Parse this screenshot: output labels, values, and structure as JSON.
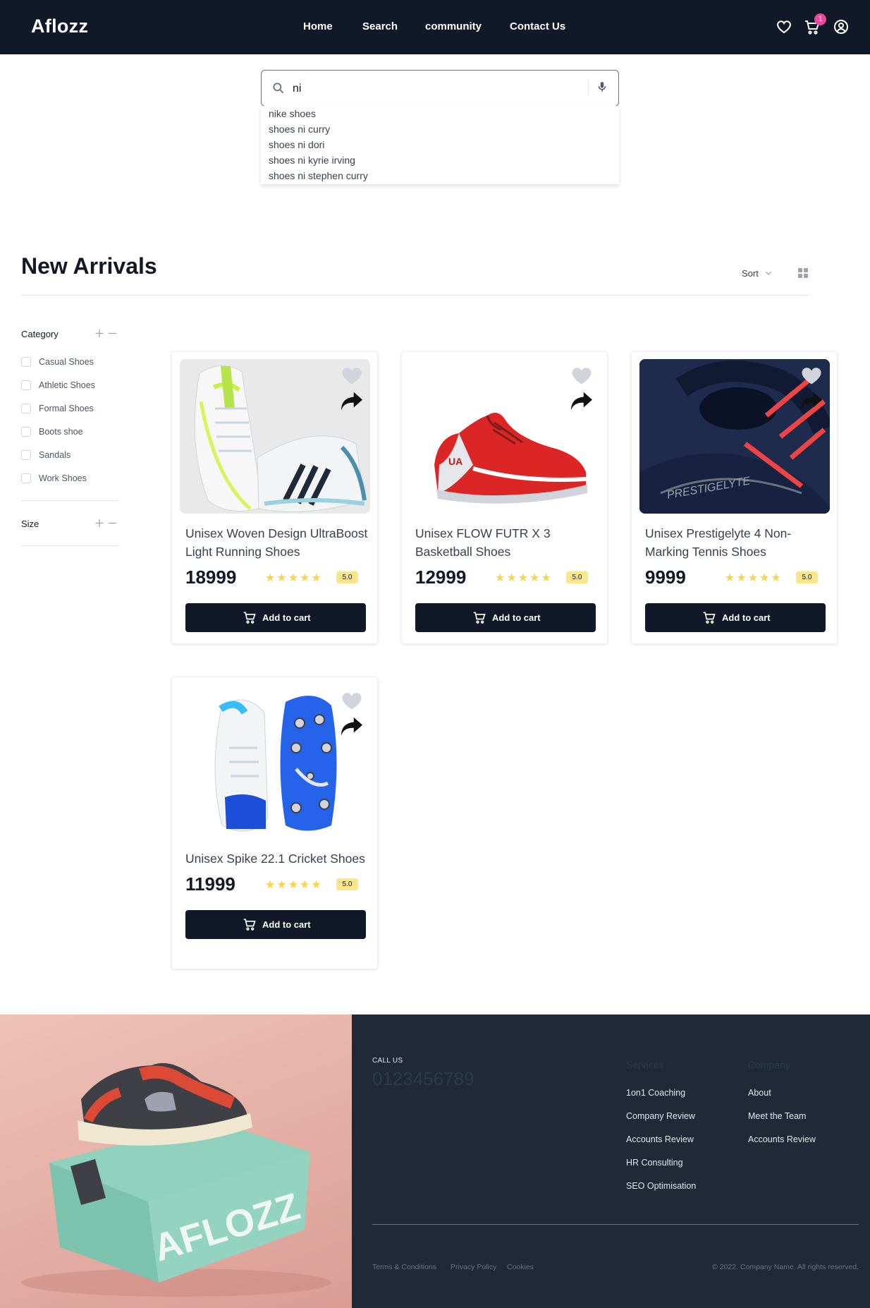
{
  "header": {
    "logo": "Aflozz",
    "nav": [
      "Home",
      "Search",
      "community",
      "Contact Us"
    ],
    "cart_count": "1"
  },
  "search": {
    "value": "ni",
    "placeholder": "",
    "suggestions": [
      "nike shoes",
      "shoes ni curry",
      "shoes ni dori",
      "shoes ni kyrie irving",
      "shoes ni stephen curry"
    ]
  },
  "section": {
    "title": "New Arrivals",
    "sort_label": "Sort"
  },
  "filters": {
    "category": {
      "label": "Category",
      "options": [
        "Casual Shoes",
        "Athletic Shoes",
        "Formal Shoes",
        "Boots shoe",
        "Sandals",
        "Work Shoes"
      ]
    },
    "size": {
      "label": "Size"
    }
  },
  "products": [
    {
      "name": "Unisex Woven Design UltraBoost Light Running Shoes",
      "price": "18999",
      "rating": "5.0",
      "stars": 5,
      "cta": "Add to cart"
    },
    {
      "name": "Unisex FLOW FUTR X 3 Basketball Shoes",
      "price": "12999",
      "rating": "5.0",
      "stars": 5,
      "cta": "Add to cart"
    },
    {
      "name": "Unisex Prestigelyte 4 Non-Marking Tennis Shoes",
      "price": "9999",
      "rating": "5.0",
      "stars": 5,
      "cta": "Add to cart"
    },
    {
      "name": "Unisex Spike 22.1 Cricket Shoes",
      "price": "11999",
      "rating": "5.0",
      "stars": 5,
      "cta": "Add to cart"
    }
  ],
  "footer": {
    "call_us_label": "CALL US",
    "phone": "0123456789",
    "services": {
      "heading": "Services",
      "links": [
        "1on1 Coaching",
        "Company Review",
        "Accounts Review",
        "HR Consulting",
        "SEO Optimisation"
      ]
    },
    "company": {
      "heading": "Company",
      "links": [
        "About",
        "Meet the Team",
        "Accounts Review"
      ]
    },
    "legal_links": [
      "Terms & Conditions",
      "Privacy Policy",
      "Cookies"
    ],
    "copyright": "© 2022. Company Name. All rights reserved.",
    "box_brand": "AFLOZZ"
  },
  "colors": {
    "header_bg": "#111827",
    "footer_bg": "#1f2937",
    "badge": "#ec4899",
    "star": "#fcd34d",
    "rating_badge": "#fde68a"
  }
}
